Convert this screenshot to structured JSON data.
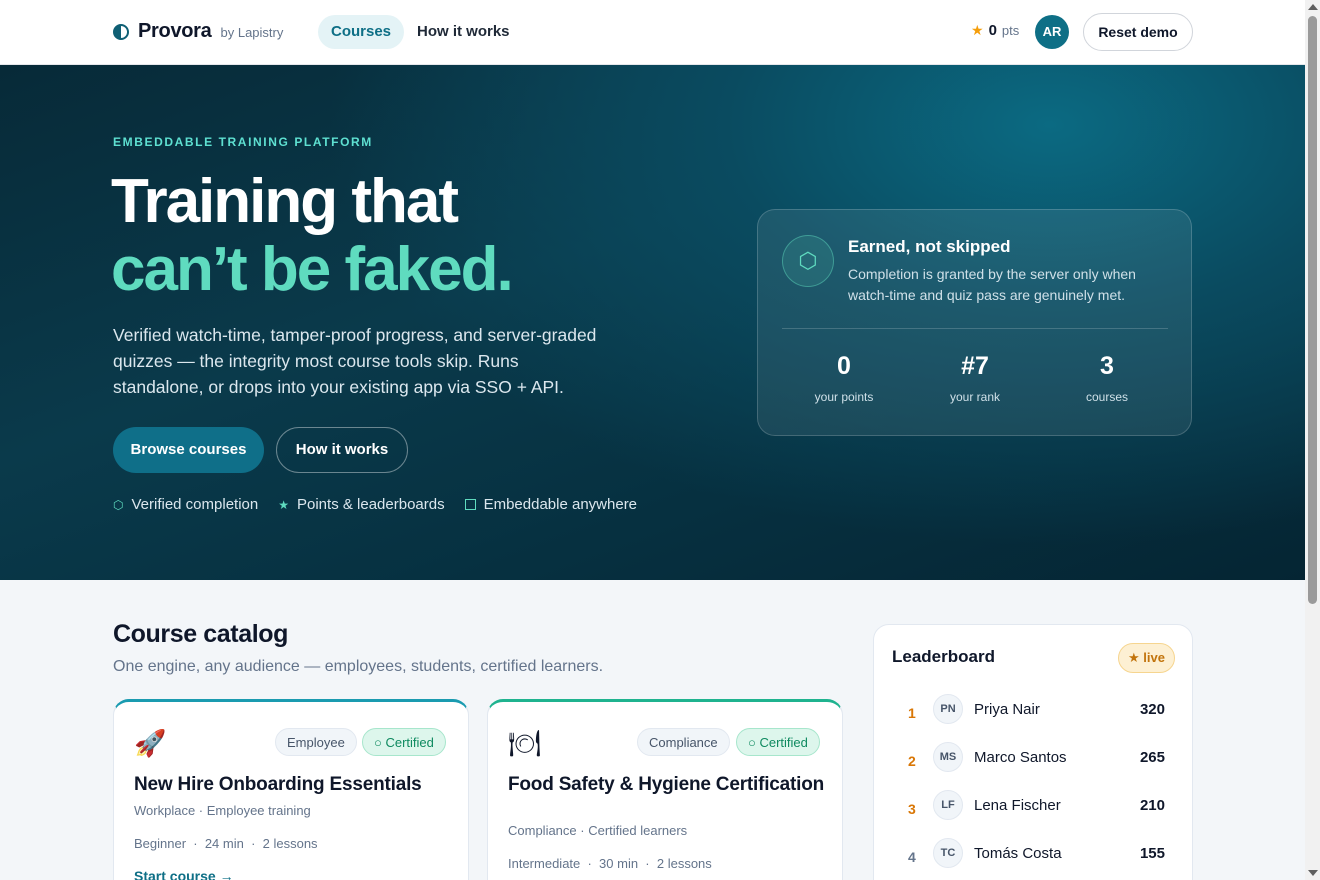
{
  "header": {
    "brand": "Provora",
    "by": "by Lapistry",
    "nav": [
      "Courses",
      "How it works"
    ],
    "points_value": "0",
    "points_unit": "pts",
    "avatar_initials": "AR",
    "reset_label": "Reset demo"
  },
  "hero": {
    "eyebrow": "EMBEDDABLE TRAINING PLATFORM",
    "headline_line1": "Training that",
    "headline_line2": "can’t be faked.",
    "description": "Verified watch-time, tamper-proof progress, and server-graded quizzes — the integrity most course tools skip. Runs standalone, or drops into your existing app via SSO + API.",
    "primary_button": "Browse courses",
    "secondary_button": "How it works",
    "features": [
      "Verified completion",
      "Points & leaderboards",
      "Embeddable anywhere"
    ]
  },
  "stats_card": {
    "title": "Earned, not skipped",
    "text": "Completion is granted by the server only when watch-time and quiz pass are genuinely met.",
    "stats": [
      {
        "value": "0",
        "label": "your points"
      },
      {
        "value": "#7",
        "label": "your rank"
      },
      {
        "value": "3",
        "label": "courses"
      }
    ]
  },
  "catalog": {
    "title": "Course catalog",
    "subtitle": "One engine, any audience — employees, students, certified learners.",
    "courses": [
      {
        "icon": "rocket-icon",
        "emoji": "🚀",
        "tag1": "Employee",
        "tag2": "Certified",
        "title": "New Hire Onboarding Essentials",
        "category": "Workplace · Employee training",
        "level": "Beginner",
        "duration": "24 min",
        "lessons": "2 lessons",
        "cta": "Start course →"
      },
      {
        "icon": "plate-icon",
        "emoji": "🍽",
        "tag1": "Compliance",
        "tag2": "Certified",
        "title": "Food Safety & Hygiene Certification",
        "category": "Compliance · Certified learners",
        "level": "Intermediate",
        "duration": "30 min",
        "lessons": "2 lessons"
      }
    ]
  },
  "leaderboard": {
    "title": "Leaderboard",
    "badge": "★ live",
    "rows": [
      {
        "rank": "1",
        "initials": "PN",
        "name": "Priya Nair",
        "score": "320",
        "rank_color": "#d97706"
      },
      {
        "rank": "2",
        "initials": "MS",
        "name": "Marco Santos",
        "score": "265",
        "rank_color": "#d97706"
      },
      {
        "rank": "3",
        "initials": "LF",
        "name": "Lena Fischer",
        "score": "210",
        "rank_color": "#d97706"
      },
      {
        "rank": "4",
        "initials": "TC",
        "name": "Tomás Costa",
        "score": "155",
        "rank_color": "#64748b"
      }
    ]
  },
  "colors": {
    "accent": "#0e6f86",
    "hero_highlight": "#5fdbbf",
    "certified_green": "#0f8a60"
  }
}
